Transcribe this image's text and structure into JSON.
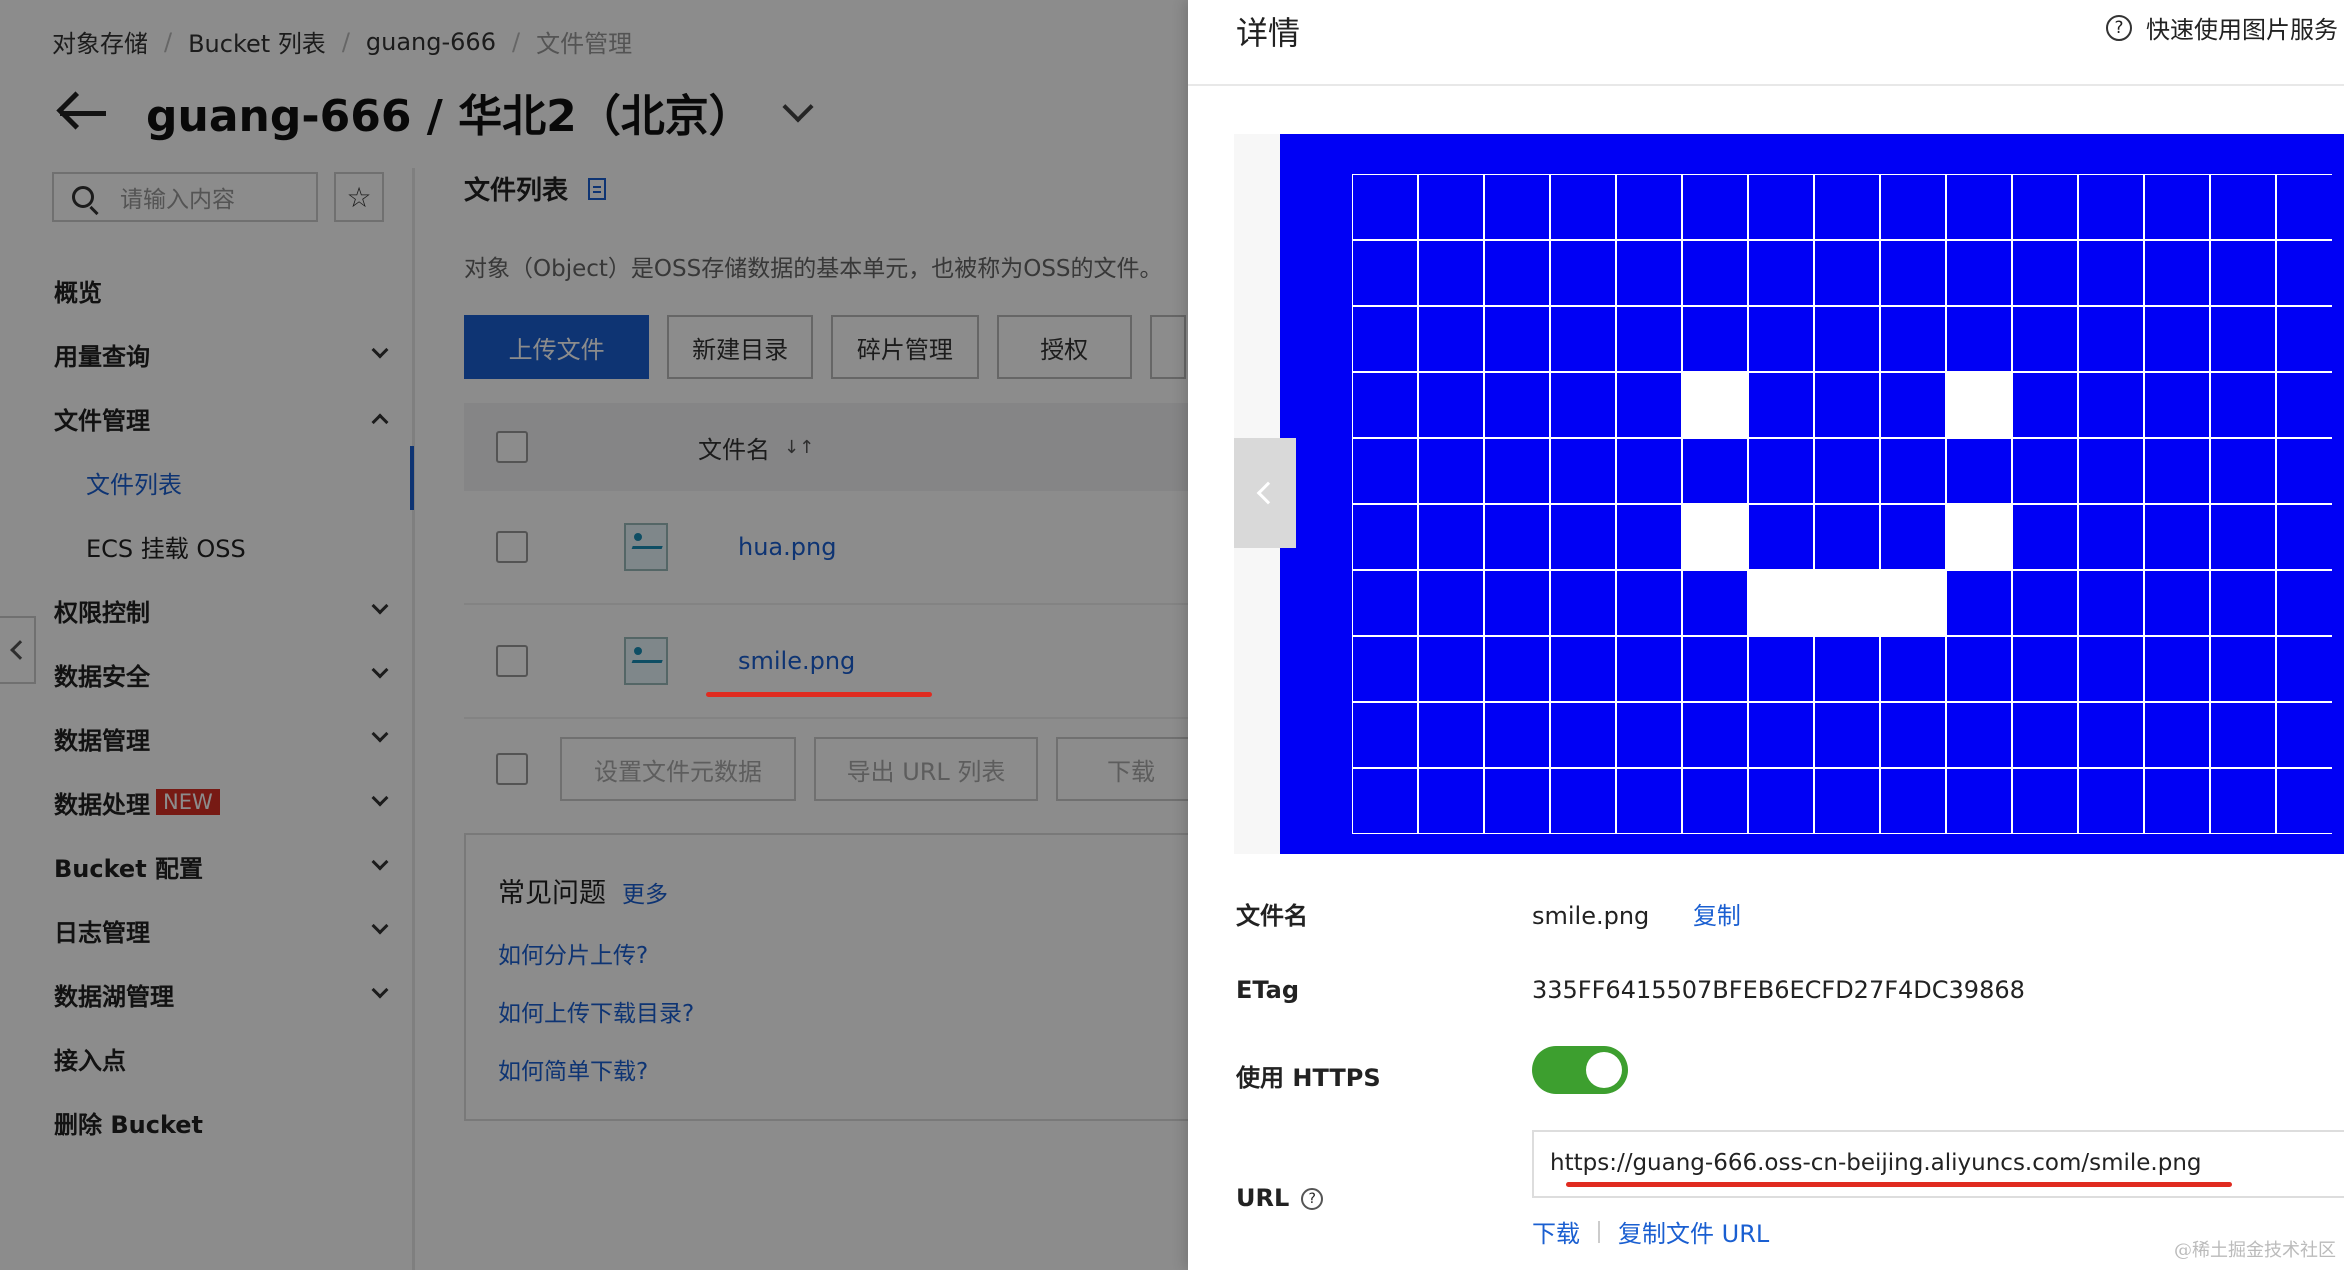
{
  "breadcrumb": [
    "对象存储",
    "Bucket 列表",
    "guang-666",
    "文件管理"
  ],
  "page_title": "guang-666 / 华北2（北京）",
  "search": {
    "placeholder": "请输入内容"
  },
  "sidebar": {
    "items": [
      {
        "label": "概览"
      },
      {
        "label": "用量查询"
      },
      {
        "label": "文件管理"
      },
      {
        "label": "文件列表"
      },
      {
        "label": "ECS 挂载 OSS"
      },
      {
        "label": "权限控制"
      },
      {
        "label": "数据安全"
      },
      {
        "label": "数据管理"
      },
      {
        "label": "数据处理",
        "badge": "NEW"
      },
      {
        "label": "Bucket 配置"
      },
      {
        "label": "日志管理"
      },
      {
        "label": "数据湖管理"
      },
      {
        "label": "接入点"
      },
      {
        "label": "删除 Bucket"
      }
    ]
  },
  "main": {
    "section_title": "文件列表",
    "description": "对象（Object）是OSS存储数据的基本单元，也被称为OSS的文件。",
    "buttons": {
      "upload": "上传文件",
      "new_dir": "新建目录",
      "fragments": "碎片管理",
      "authorize": "授权"
    },
    "table": {
      "header_filename": "文件名",
      "sort_icon": "↓↑",
      "rows": [
        {
          "name": "hua.png"
        },
        {
          "name": "smile.png"
        }
      ]
    },
    "footer_buttons": {
      "set_meta": "设置文件元数据",
      "export_urls": "导出 URL 列表",
      "download": "下载"
    },
    "faq": {
      "title": "常见问题",
      "more": "更多",
      "links": [
        "如何分片上传?",
        "如何上传下载目录?",
        "如何简单下载?"
      ]
    }
  },
  "drawer": {
    "title": "详情",
    "help_icon": "?",
    "help_link": "快速使用图片服务",
    "preview": {
      "background": "#0000f5",
      "cell_color": "#0000f5",
      "line_color": "#ffffff",
      "cols": 15,
      "rows": 10
    },
    "filename_label": "文件名",
    "filename_value": "smile.png",
    "copy_label": "复制",
    "etag_label": "ETag",
    "etag_value": "335FF6415507BFEB6ECFD27F4DC39868",
    "https_label": "使用 HTTPS",
    "https_enabled": true,
    "url_label": "URL",
    "url_value": "https://guang-666.oss-cn-beijing.aliyuncs.com/smile.png",
    "download_label": "下载",
    "copy_url_label": "复制文件 URL"
  },
  "watermark": "@稀土掘金技术社区",
  "colors": {
    "accent": "#1a5fd1",
    "danger": "#e02b20",
    "toggle_on": "#3d9f2f",
    "badge": "#d93026"
  }
}
